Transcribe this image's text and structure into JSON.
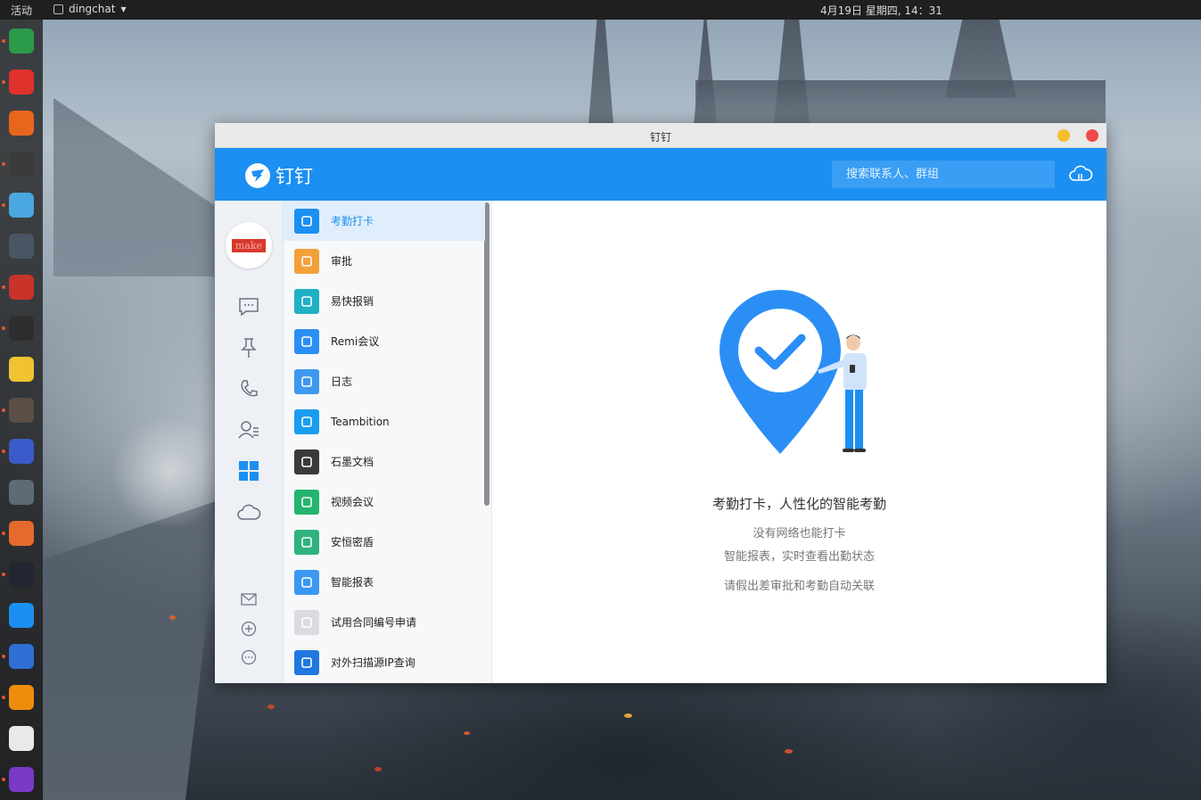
{
  "topbar": {
    "activities": "活动",
    "app_name": "dingchat",
    "app_menu_arrow": "▾",
    "clock": "4月19日 星期四, 14：31"
  },
  "dock": {
    "apps": [
      {
        "icon": "system-monitor-icon",
        "color": "#2b9a4a"
      },
      {
        "icon": "netease-music-icon",
        "color": "#e0322d"
      },
      {
        "icon": "firefox-icon",
        "color": "#e8651c"
      },
      {
        "icon": "update-info-icon",
        "color": "#3b3b3b"
      },
      {
        "icon": "archive-icon",
        "color": "#4aa7e0"
      },
      {
        "icon": "screenshot-icon",
        "color": "#4a5664"
      },
      {
        "icon": "screen-recorder-icon",
        "color": "#c8342a"
      },
      {
        "icon": "terminal-icon",
        "color": "#2e2e2e"
      },
      {
        "icon": "chrome-icon",
        "color": "#f1c232"
      },
      {
        "icon": "atom-icon",
        "color": "#5b4e45"
      },
      {
        "icon": "visual-studio-code-icon",
        "color": "#3a5bc9"
      },
      {
        "icon": "remote-desktop-icon",
        "color": "#5e6b77"
      },
      {
        "icon": "postman-icon",
        "color": "#e56a2c"
      },
      {
        "icon": "goland-icon",
        "color": "#222631"
      },
      {
        "icon": "dingtalk-icon",
        "color": "#1c8ff2"
      },
      {
        "icon": "todo-icon",
        "color": "#2f6fd3"
      },
      {
        "icon": "vlc-icon",
        "color": "#f08c0c"
      },
      {
        "icon": "text-editor-icon",
        "color": "#e9e9e9"
      },
      {
        "icon": "goland-alt-icon",
        "color": "#7a39c7"
      }
    ]
  },
  "window": {
    "title": "钉钉",
    "brand": "钉钉",
    "search": {
      "placeholder": "搜索联系人、群组"
    },
    "avatar_text": "make"
  },
  "nav": {
    "icons": [
      "chat-icon",
      "pin-icon",
      "phone-icon",
      "contacts-icon",
      "workbench-icon",
      "cloud-disk-icon"
    ],
    "bottom_icons": [
      "mail-icon",
      "add-icon",
      "more-icon"
    ]
  },
  "apps": [
    {
      "label": "考勤打卡",
      "icon": "attendance-icon",
      "color": "#1c8ff2"
    },
    {
      "label": "审批",
      "icon": "approval-icon",
      "color": "#f2a13a"
    },
    {
      "label": "易快报销",
      "icon": "expense-icon",
      "color": "#1fb0c4"
    },
    {
      "label": "Remi会议",
      "icon": "remi-meeting-icon",
      "color": "#2b8ef5"
    },
    {
      "label": "日志",
      "icon": "log-icon",
      "color": "#3e98ef"
    },
    {
      "label": "Teambition",
      "icon": "teambition-icon",
      "color": "#1a9cf0"
    },
    {
      "label": "石墨文档",
      "icon": "shimo-docs-icon",
      "color": "#3a3a3a"
    },
    {
      "label": "视频会议",
      "icon": "video-meeting-icon",
      "color": "#24b46e"
    },
    {
      "label": "安恒密盾",
      "icon": "security-shield-icon",
      "color": "#2fb37e"
    },
    {
      "label": "智能报表",
      "icon": "smart-report-icon",
      "color": "#3b98f0"
    },
    {
      "label": "试用合同编号申请",
      "icon": "contract-icon",
      "color": "#d9dbe0"
    },
    {
      "label": "对外扫描源IP查询",
      "icon": "ip-scan-icon",
      "color": "#1f78e0"
    }
  ],
  "main": {
    "title": "考勤打卡，人性化的智能考勤",
    "line1": "没有网络也能打卡",
    "line2": "智能报表，实时查看出勤状态",
    "line3": "请假出差审批和考勤自动关联"
  },
  "colors": {
    "brand_blue": "#1c8ff2",
    "active_row": "#e0eefb"
  }
}
